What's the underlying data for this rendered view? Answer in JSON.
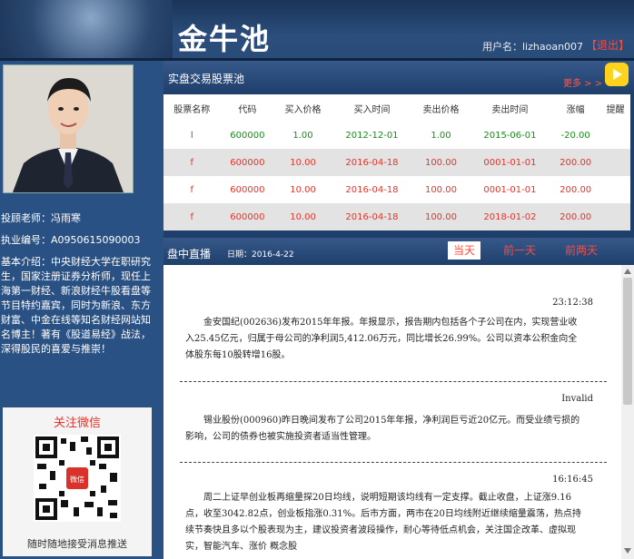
{
  "header": {
    "title": "金牛池",
    "user_label": "用户名：lizhaoan007",
    "logout": "【退出】"
  },
  "advisor": {
    "name_line": "投顾老师：冯雨寒",
    "license_line": "执业编号：A0950615090003",
    "intro": "基本介绍：中央财经大学在职研究生，国家注册证券分析师，现任上海第一财经、新浪财经牛股看盘等节目特约嘉宾，同时为新浪、东方财富、中金在线等知名财经网站知名博主！著有《股道易经》战法，深得股民的喜爱与推崇！"
  },
  "wechat": {
    "title": "关注微信",
    "note": "随时随地接受消息推送",
    "qr_caption": "微信"
  },
  "stock_pool": {
    "title": "实盘交易股票池",
    "more": "更多 > >",
    "columns": [
      "股票名称",
      "代码",
      "买入价格",
      "买入时间",
      "卖出价格",
      "卖出时间",
      "涨幅",
      "提醒"
    ],
    "rows": [
      [
        "l",
        "600000",
        "1.00",
        "2012-12-01",
        "1.00",
        "2015-06-01",
        "-20.00",
        ""
      ],
      [
        "f",
        "600000",
        "10.00",
        "2016-04-18",
        "100.00",
        "0001-01-01",
        "200.00",
        ""
      ],
      [
        "f",
        "600000",
        "10.00",
        "2016-04-18",
        "100.00",
        "0001-01-01",
        "200.00",
        ""
      ],
      [
        "f",
        "600000",
        "10.00",
        "2016-04-18",
        "100.00",
        "2018-01-02",
        "200.00",
        ""
      ]
    ]
  },
  "live": {
    "title": "盘中直播",
    "date": "日期：2016-4-22",
    "tabs": [
      "当天",
      "前一天",
      "前两天"
    ],
    "messages": [
      {
        "time": "23:12:38",
        "text": "金安国纪(002636)发布2015年年报。年报显示，报告期内包括各个子公司在内，实现营业收入25.45亿元，归属于母公司的净利润5,412.06万元，同比增长26.99%。公司以资本公积金向全体股东每10股转增16股。"
      },
      {
        "time": "Invalid",
        "text": "锡业股份(000960)昨日晚间发布了公司2015年年报，净利润巨亏近20亿元。而受业绩亏损的影响，公司的债券也被实施投资者适当性管理。"
      },
      {
        "time": "16:16:45",
        "text": "周二上证早创业板再缩量探20日均线，说明短期该均线有一定支撑。截止收盘，上证涨9.16点，收至3042.82点，创业板指涨0.31%。后市方面，两市在20日均线附近继续缩量震荡，热点持续节奏快且多以个股表现为主，建议投资者波段操作，耐心等待低点机会，关注国企改革、虚拟现实，智能汽车、涨价 概念股"
      }
    ]
  }
}
